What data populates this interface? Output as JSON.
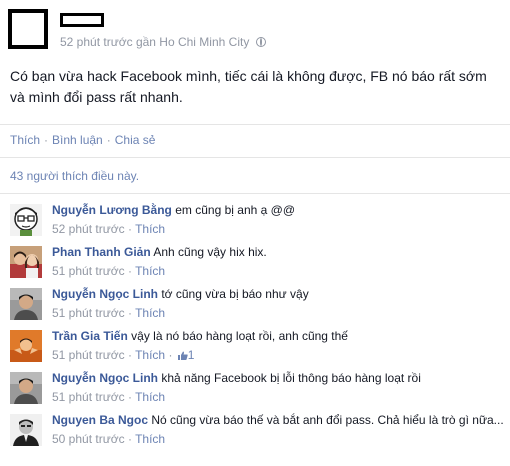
{
  "post": {
    "time_location": "52 phút trước gần Ho Chi Minh City",
    "text": "Có bạn vừa hack Facebook mình, tiếc cái là không được, FB nó báo rất sớm và mình đổi pass rất nhanh."
  },
  "actions": {
    "like": "Thích",
    "comment": "Bình luận",
    "share": "Chia sẻ",
    "separator": "·"
  },
  "likes_summary": "43 người thích điều này.",
  "comments": [
    {
      "author": "Nguyễn Lương Bằng",
      "text": "em cũng bị anh ạ @@",
      "time": "52 phút trước",
      "like": "Thích"
    },
    {
      "author": "Phan Thanh Giản",
      "text": "Anh cũng vậy hix hix.",
      "time": "51 phút trước",
      "like": "Thích"
    },
    {
      "author": "Nguyễn Ngọc Linh",
      "text": "tớ cũng vừa bị báo như vậy",
      "time": "51 phút trước",
      "like": "Thích"
    },
    {
      "author": "Trần Gia Tiến",
      "text": "vậy là nó báo hàng loạt rồi, anh cũng thế",
      "time": "51 phút trước",
      "like": "Thích",
      "like_count": "1"
    },
    {
      "author": "Nguyễn Ngọc Linh",
      "text": "khả năng Facebook bị lỗi thông báo hàng loạt rồi",
      "time": "51 phút trước",
      "like": "Thích"
    },
    {
      "author": "Nguyen Ba Ngoc",
      "text": "Nó cũng vừa báo thế và bắt anh đổi pass. Chả hiểu là trò gì nữa...",
      "time": "50 phút trước",
      "like": "Thích"
    }
  ],
  "colors": {
    "link": "#6d84b4",
    "author": "#3b5998",
    "meta": "#9197a3",
    "separator": "#e5e5e5"
  }
}
